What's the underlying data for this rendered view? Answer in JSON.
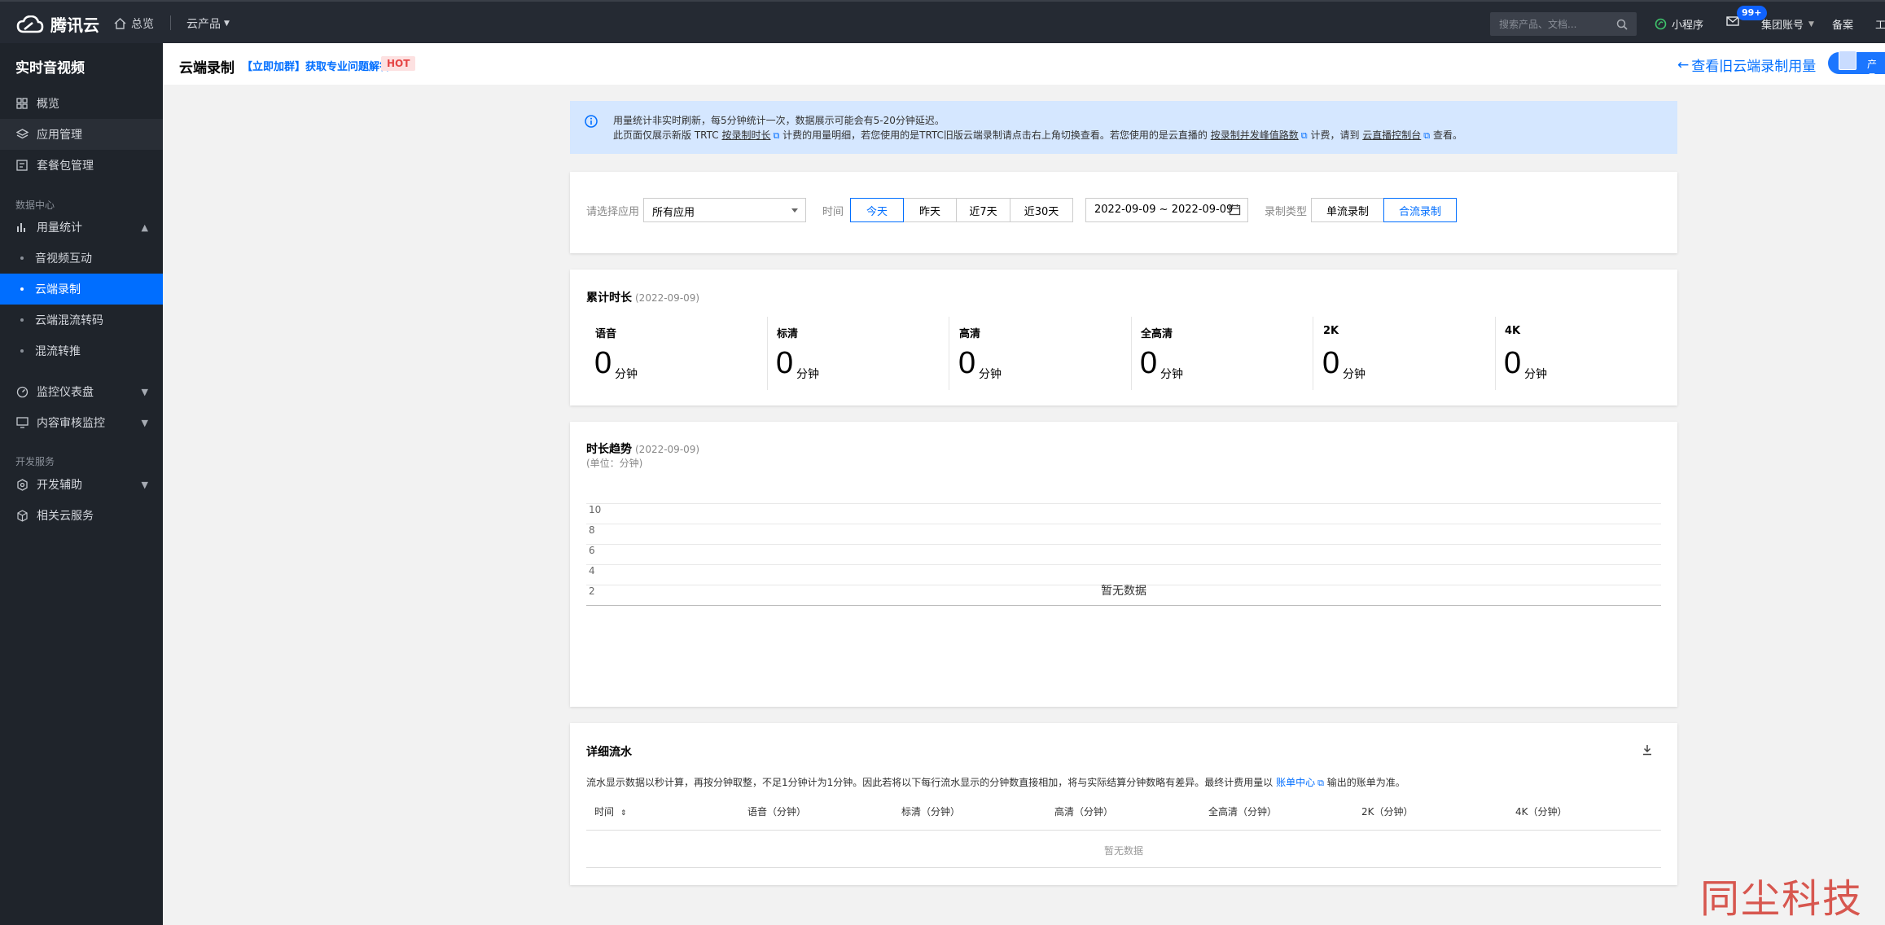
{
  "topbar": {
    "logo_text": "腾讯云",
    "home_label": "总览",
    "products_label": "云产品",
    "search_placeholder": "搜索产品、文档...",
    "mini_program": "小程序",
    "message_badge": "99+",
    "account": "集团账号",
    "beian": "备案",
    "tools_partial": "工"
  },
  "sidebar": {
    "title": "实时音视频",
    "items": [
      {
        "label": "概览",
        "icon": "grid-icon"
      },
      {
        "label": "应用管理",
        "icon": "layers-icon"
      },
      {
        "label": "套餐包管理",
        "icon": "package-icon"
      }
    ],
    "group_data": "数据中心",
    "usage": {
      "label": "用量统计",
      "icon": "bar-chart-icon"
    },
    "usage_subs": [
      "音视频互动",
      "云端录制",
      "云端混流转码",
      "混流转推"
    ],
    "active_sub": "云端录制",
    "monitor": {
      "label": "监控仪表盘",
      "icon": "gauge-icon"
    },
    "audit": {
      "label": "内容审核监控",
      "icon": "monitor-icon"
    },
    "group_dev": "开发服务",
    "devhelp": {
      "label": "开发辅助",
      "icon": "gear-icon"
    },
    "related": {
      "label": "相关云服务",
      "icon": "cube-icon"
    }
  },
  "header": {
    "title": "云端录制",
    "promo_link": "【立即加群】获取专业问题解答",
    "hot": "HOT",
    "old_link": "查看旧云端录制用量",
    "pill_text": "产品"
  },
  "notice": {
    "line1": "用量统计非实时刷新，每5分钟统计一次，数据展示可能会有5-20分钟延迟。",
    "line2_a": "此页面仅展示新版 TRTC ",
    "link1": "按录制时长",
    "line2_b": " 计费的用量明细，若您使用的是TRTC旧版云端录制请点击右上角切换查看。若您使用的是云直播的 ",
    "link2": "按录制并发峰值路数",
    "line2_c": " 计费，请到 ",
    "link3": "云直播控制台",
    "line2_d": " 查看。"
  },
  "filter": {
    "app_label": "请选择应用",
    "app_value": "所有应用",
    "time_label": "时间",
    "time_options": [
      "今天",
      "昨天",
      "近7天",
      "近30天"
    ],
    "time_selected": "今天",
    "date_range": "2022-09-09 ~ 2022-09-09",
    "type_label": "录制类型",
    "type_options": [
      "单流录制",
      "合流录制"
    ],
    "type_selected": "合流录制"
  },
  "totals": {
    "title": "累计时长",
    "date": "(2022-09-09)",
    "unit": "分钟",
    "items": [
      {
        "label": "语音",
        "value": "0"
      },
      {
        "label": "标清",
        "value": "0"
      },
      {
        "label": "高清",
        "value": "0"
      },
      {
        "label": "全高清",
        "value": "0"
      },
      {
        "label": "2K",
        "value": "0"
      },
      {
        "label": "4K",
        "value": "0"
      }
    ]
  },
  "trend": {
    "title": "时长趋势",
    "date": "(2022-09-09)",
    "unit_note": "(单位：分钟)",
    "no_data": "暂无数据"
  },
  "chart_data": {
    "type": "line",
    "title": "时长趋势",
    "ylabel": "分钟",
    "ylim": [
      0,
      10
    ],
    "yticks": [
      "10",
      "8",
      "6",
      "4",
      "2"
    ],
    "series": [],
    "grid": true
  },
  "detail": {
    "title": "详细流水",
    "desc_a": "流水显示数据以秒计算，再按分钟取整，不足1分钟计为1分钟。因此若将以下每行流水显示的分钟数直接相加，将与实际结算分钟数略有差异。最终计费用量以 ",
    "desc_link": "账单中心",
    "desc_b": " 输出的账单为准。",
    "columns": [
      "时间",
      "语音（分钟）",
      "标清（分钟）",
      "高清（分钟）",
      "全高清（分钟）",
      "2K（分钟）",
      "4K（分钟）"
    ],
    "empty": "暂无数据"
  },
  "watermark": "同尘科技",
  "colors": {
    "accent": "#006eff",
    "sidebar_bg": "#1f242b",
    "topbar_bg": "#252a33",
    "hot_text": "#e54545"
  }
}
